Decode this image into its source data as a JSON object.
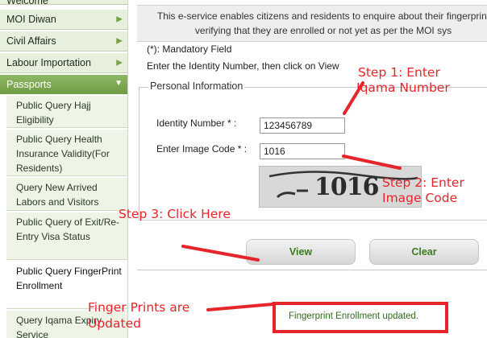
{
  "sidebar": {
    "top_partial": "Welcome",
    "items": [
      {
        "label": "MOI Diwan"
      },
      {
        "label": "Civil Affairs"
      },
      {
        "label": "Labour Importation"
      }
    ],
    "section": {
      "label": "Passports"
    },
    "subitems": [
      {
        "label": "Public Query Hajj Eligibility"
      },
      {
        "label": "Public Query Health Insurance Validity(For Residents)"
      },
      {
        "label": "Query New Arrived Labors and Visitors"
      },
      {
        "label": "Public Query of Exit/Re-Entry Visa Status"
      },
      {
        "label": "Public Query FingerPrint Enrollment"
      },
      {
        "label": "Query Iqama Expiry Service"
      }
    ]
  },
  "notice": {
    "line1": "This e-service enables citizens and residents to enquire about their fingerprint",
    "line2": "verifying that they are enrolled or not yet as per the MOI sys"
  },
  "form": {
    "mandatory_note": "(*): Mandatory Field",
    "instruction": "Enter the Identity Number, then click on View",
    "legend": "Personal Information",
    "identity_label": "Identity Number * :",
    "identity_value": "123456789",
    "image_code_label": "Enter Image Code * :",
    "image_code_value": "1016",
    "captcha_text": "1016"
  },
  "buttons": {
    "view": "View",
    "clear": "Clear"
  },
  "result": {
    "message": "Fingerprint Enrollment updated."
  },
  "annotations": {
    "step1_line1": "Step 1: Enter",
    "step1_line2": "Iqama Number",
    "step2_line1": "Step 2: Enter",
    "step2_line2": "Image Code",
    "step3": "Step 3: Click Here",
    "finger_line1": "Finger Prints are",
    "finger_line2": "Updated"
  },
  "colors": {
    "annotation": "#e6252a",
    "accent_green": "#6f9b44",
    "button_text": "#3d7a1f"
  }
}
